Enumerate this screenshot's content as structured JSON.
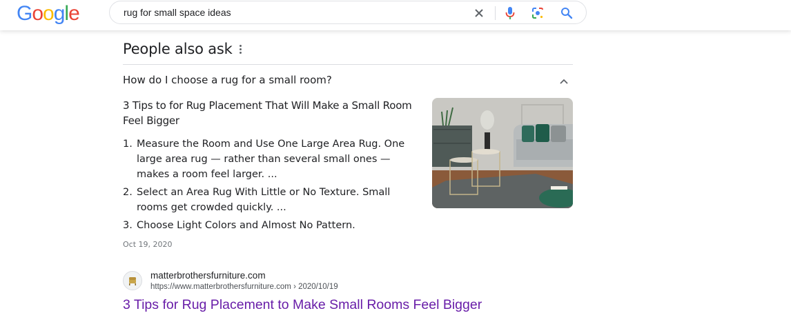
{
  "logo": {
    "letters": [
      "G",
      "o",
      "o",
      "g",
      "l",
      "e"
    ],
    "colors": [
      "#4285F4",
      "#EA4335",
      "#FBBC05",
      "#4285F4",
      "#34A853",
      "#EA4335"
    ]
  },
  "search": {
    "query": "rug for small space ideas",
    "icons": [
      "clear-icon",
      "microphone-icon",
      "lens-icon",
      "search-icon"
    ]
  },
  "people_also_ask": {
    "title": "People also ask",
    "question": "How do I choose a rug for a small room?",
    "answer": {
      "heading": "3 Tips to for Rug Placement That Will Make a Small Room Feel Bigger",
      "items": [
        {
          "num": "1.",
          "text": "Measure the Room and Use One Large Area Rug. One large area rug — rather than several small ones — makes a room feel larger. ..."
        },
        {
          "num": "2.",
          "text": "Select an Area Rug With Little or No Texture. Small rooms get crowded quickly. ..."
        },
        {
          "num": "3.",
          "text": "Choose Light Colors and Almost No Pattern."
        }
      ],
      "date": "Oct 19, 2020"
    }
  },
  "result": {
    "site_name": "matterbrothersfurniture.com",
    "url": "https://www.matterbrothersfurniture.com › 2020/10/19",
    "title": "3 Tips for Rug Placement to Make Small Rooms Feel Bigger"
  },
  "colors": {
    "link_visited": "#681da8",
    "search_blue": "#4285F4"
  }
}
